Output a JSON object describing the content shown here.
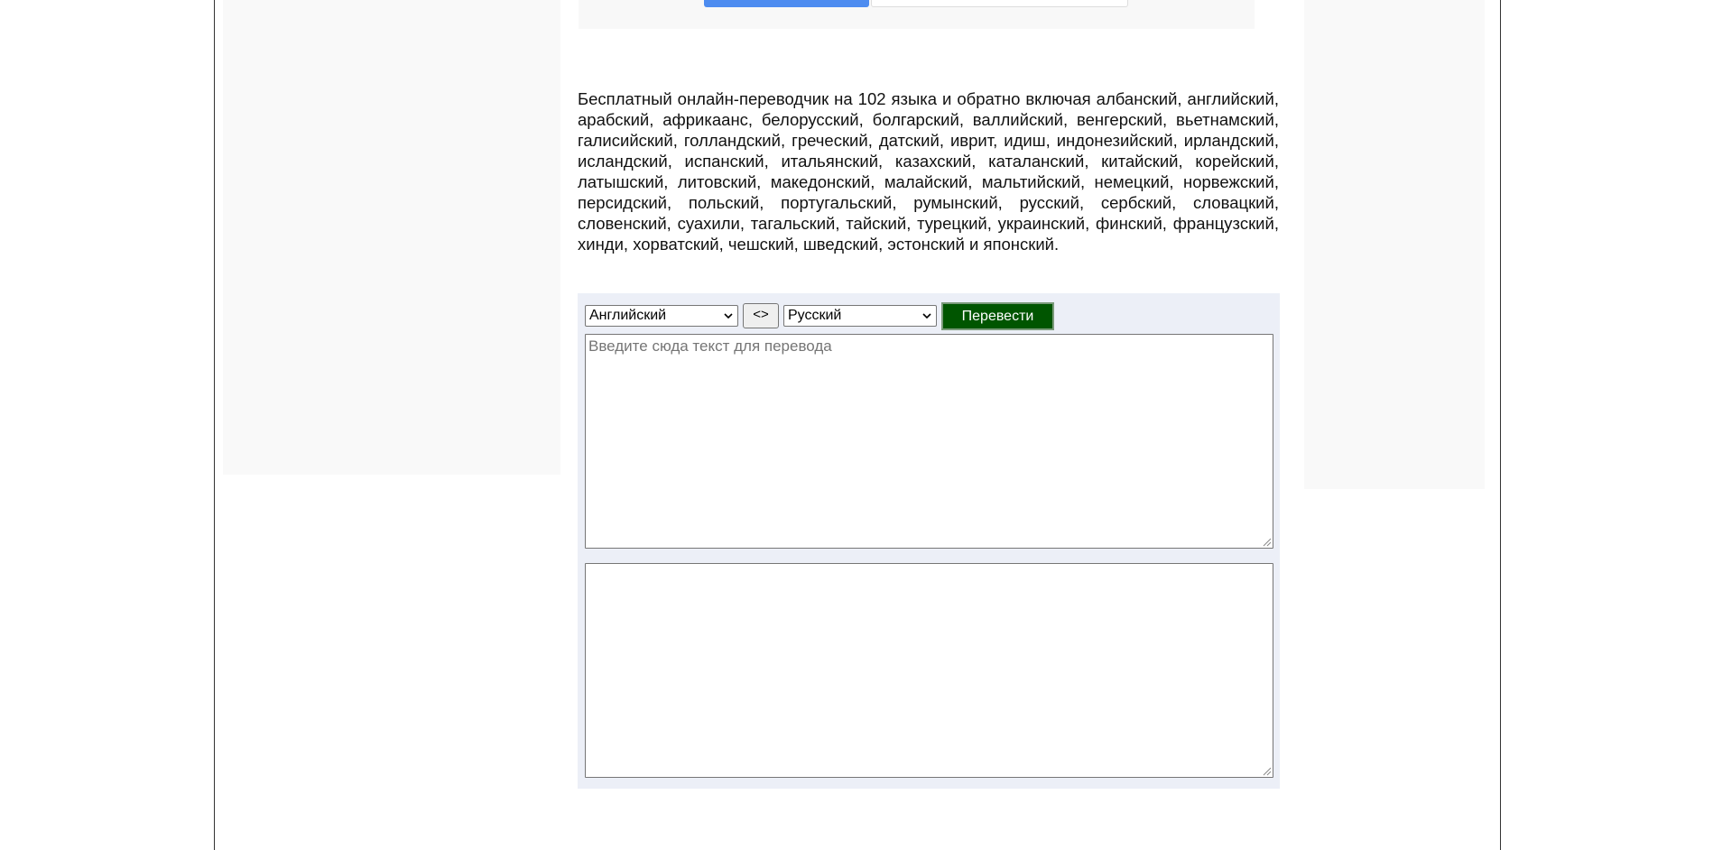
{
  "description": "Бесплатный онлайн-переводчик на 102 языка и обратно включая албанский, английский, арабский, африкаанс, белорусский, болгарский, валлийский, венгерский, вьетнамский, галисийский, голландский, греческий, датский, иврит, идиш, индонезийский, ирландский, исландский, испанский, итальянский, казахский, каталанский, китайский, корейский, латышский, литовский, македонский, малайский, мальтийский, немецкий, норвежский, персидский, польский, португальский, румынский, русский, сербский, словацкий, словенский, суахили, тагальский, тайский, турецкий, украинский, финский, французский, хинди, хорватский, чешский, шведский, эстонский и японский.",
  "translator": {
    "source_language": "Английский",
    "target_language": "Русский",
    "swap_label": "<>",
    "translate_label": "Перевести",
    "input_placeholder": "Введите сюда текст для перевода",
    "input_value": "",
    "output_value": ""
  },
  "colors": {
    "translate_button": "#005500",
    "translator_panel": "#eceff7",
    "top_button_accent": "#4d8cf0"
  }
}
